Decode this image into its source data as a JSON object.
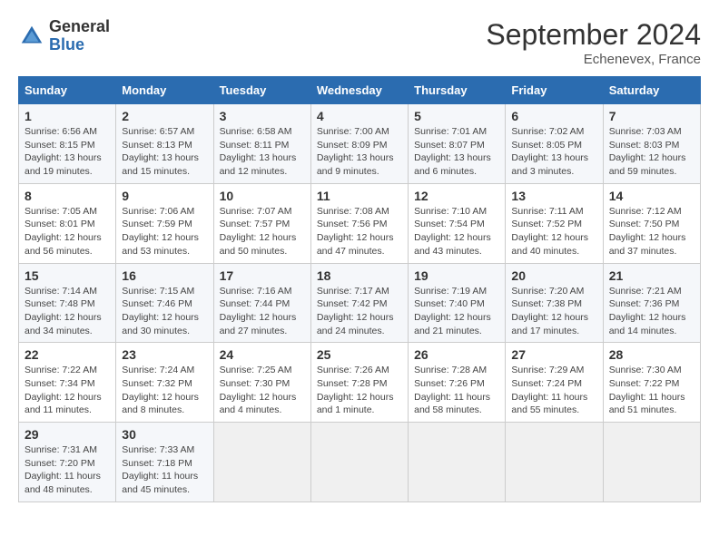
{
  "logo": {
    "general": "General",
    "blue": "Blue"
  },
  "header": {
    "month": "September 2024",
    "location": "Echenevex, France"
  },
  "weekdays": [
    "Sunday",
    "Monday",
    "Tuesday",
    "Wednesday",
    "Thursday",
    "Friday",
    "Saturday"
  ],
  "weeks": [
    [
      {
        "day": "1",
        "info": "Sunrise: 6:56 AM\nSunset: 8:15 PM\nDaylight: 13 hours and 19 minutes."
      },
      {
        "day": "2",
        "info": "Sunrise: 6:57 AM\nSunset: 8:13 PM\nDaylight: 13 hours and 15 minutes."
      },
      {
        "day": "3",
        "info": "Sunrise: 6:58 AM\nSunset: 8:11 PM\nDaylight: 13 hours and 12 minutes."
      },
      {
        "day": "4",
        "info": "Sunrise: 7:00 AM\nSunset: 8:09 PM\nDaylight: 13 hours and 9 minutes."
      },
      {
        "day": "5",
        "info": "Sunrise: 7:01 AM\nSunset: 8:07 PM\nDaylight: 13 hours and 6 minutes."
      },
      {
        "day": "6",
        "info": "Sunrise: 7:02 AM\nSunset: 8:05 PM\nDaylight: 13 hours and 3 minutes."
      },
      {
        "day": "7",
        "info": "Sunrise: 7:03 AM\nSunset: 8:03 PM\nDaylight: 12 hours and 59 minutes."
      }
    ],
    [
      {
        "day": "8",
        "info": "Sunrise: 7:05 AM\nSunset: 8:01 PM\nDaylight: 12 hours and 56 minutes."
      },
      {
        "day": "9",
        "info": "Sunrise: 7:06 AM\nSunset: 7:59 PM\nDaylight: 12 hours and 53 minutes."
      },
      {
        "day": "10",
        "info": "Sunrise: 7:07 AM\nSunset: 7:57 PM\nDaylight: 12 hours and 50 minutes."
      },
      {
        "day": "11",
        "info": "Sunrise: 7:08 AM\nSunset: 7:56 PM\nDaylight: 12 hours and 47 minutes."
      },
      {
        "day": "12",
        "info": "Sunrise: 7:10 AM\nSunset: 7:54 PM\nDaylight: 12 hours and 43 minutes."
      },
      {
        "day": "13",
        "info": "Sunrise: 7:11 AM\nSunset: 7:52 PM\nDaylight: 12 hours and 40 minutes."
      },
      {
        "day": "14",
        "info": "Sunrise: 7:12 AM\nSunset: 7:50 PM\nDaylight: 12 hours and 37 minutes."
      }
    ],
    [
      {
        "day": "15",
        "info": "Sunrise: 7:14 AM\nSunset: 7:48 PM\nDaylight: 12 hours and 34 minutes."
      },
      {
        "day": "16",
        "info": "Sunrise: 7:15 AM\nSunset: 7:46 PM\nDaylight: 12 hours and 30 minutes."
      },
      {
        "day": "17",
        "info": "Sunrise: 7:16 AM\nSunset: 7:44 PM\nDaylight: 12 hours and 27 minutes."
      },
      {
        "day": "18",
        "info": "Sunrise: 7:17 AM\nSunset: 7:42 PM\nDaylight: 12 hours and 24 minutes."
      },
      {
        "day": "19",
        "info": "Sunrise: 7:19 AM\nSunset: 7:40 PM\nDaylight: 12 hours and 21 minutes."
      },
      {
        "day": "20",
        "info": "Sunrise: 7:20 AM\nSunset: 7:38 PM\nDaylight: 12 hours and 17 minutes."
      },
      {
        "day": "21",
        "info": "Sunrise: 7:21 AM\nSunset: 7:36 PM\nDaylight: 12 hours and 14 minutes."
      }
    ],
    [
      {
        "day": "22",
        "info": "Sunrise: 7:22 AM\nSunset: 7:34 PM\nDaylight: 12 hours and 11 minutes."
      },
      {
        "day": "23",
        "info": "Sunrise: 7:24 AM\nSunset: 7:32 PM\nDaylight: 12 hours and 8 minutes."
      },
      {
        "day": "24",
        "info": "Sunrise: 7:25 AM\nSunset: 7:30 PM\nDaylight: 12 hours and 4 minutes."
      },
      {
        "day": "25",
        "info": "Sunrise: 7:26 AM\nSunset: 7:28 PM\nDaylight: 12 hours and 1 minute."
      },
      {
        "day": "26",
        "info": "Sunrise: 7:28 AM\nSunset: 7:26 PM\nDaylight: 11 hours and 58 minutes."
      },
      {
        "day": "27",
        "info": "Sunrise: 7:29 AM\nSunset: 7:24 PM\nDaylight: 11 hours and 55 minutes."
      },
      {
        "day": "28",
        "info": "Sunrise: 7:30 AM\nSunset: 7:22 PM\nDaylight: 11 hours and 51 minutes."
      }
    ],
    [
      {
        "day": "29",
        "info": "Sunrise: 7:31 AM\nSunset: 7:20 PM\nDaylight: 11 hours and 48 minutes."
      },
      {
        "day": "30",
        "info": "Sunrise: 7:33 AM\nSunset: 7:18 PM\nDaylight: 11 hours and 45 minutes."
      },
      null,
      null,
      null,
      null,
      null
    ]
  ]
}
